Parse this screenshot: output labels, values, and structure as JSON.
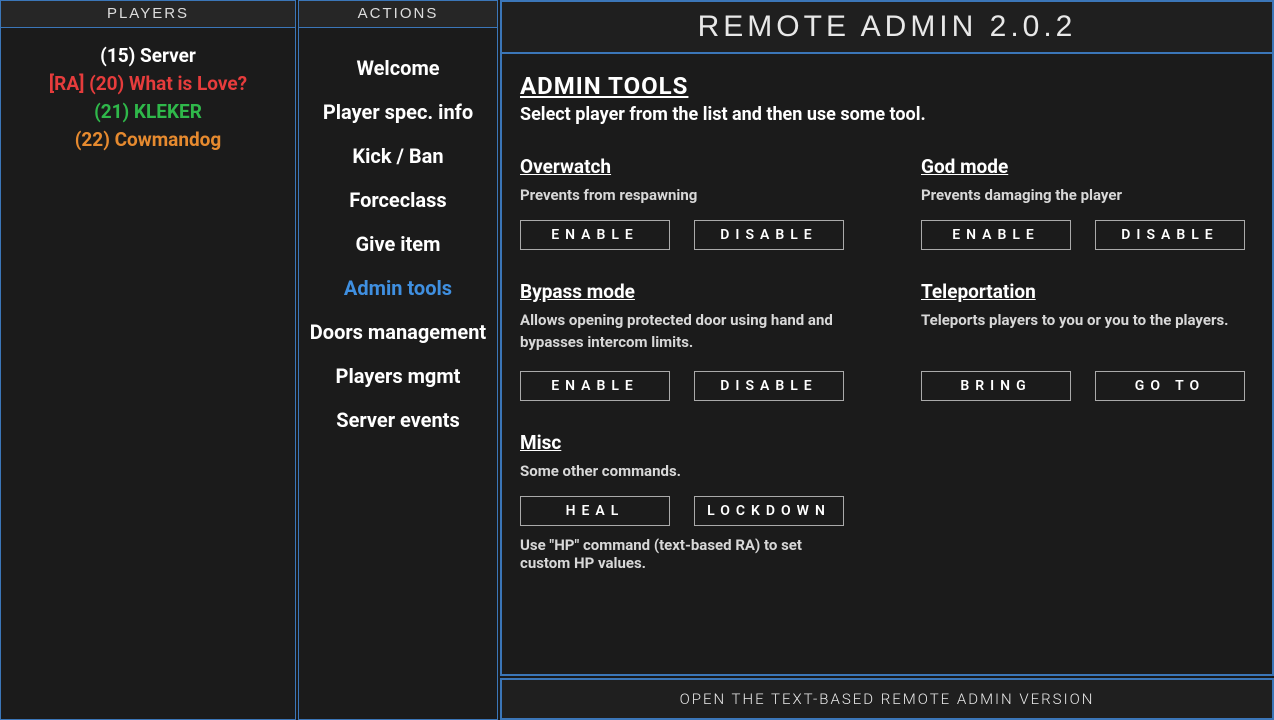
{
  "players_header": "PLAYERS",
  "actions_header": "ACTIONS",
  "players": [
    {
      "label": "(15) Server",
      "color": "#ffffff"
    },
    {
      "label": "[RA] (20) What is Love?",
      "color": "#e63c3c"
    },
    {
      "label": "(21) KLEKER",
      "color": "#2fb84a"
    },
    {
      "label": "(22) Cowmandog",
      "color": "#e68a2f"
    }
  ],
  "actions": {
    "items": [
      "Welcome",
      "Player spec. info",
      "Kick / Ban",
      "Forceclass",
      "Give item",
      "Admin tools",
      "Doors management",
      "Players mgmt",
      "Server events"
    ],
    "active_index": 5
  },
  "title": "REMOTE ADMIN 2.0.2",
  "page": {
    "title": "ADMIN TOOLS",
    "subtitle": "Select player from the list and then use some tool."
  },
  "sections": {
    "overwatch": {
      "title": "Overwatch",
      "desc": "Prevents from respawning",
      "btn1": "ENABLE",
      "btn2": "DISABLE"
    },
    "god": {
      "title": "God mode",
      "desc": "Prevents damaging the player",
      "btn1": "ENABLE",
      "btn2": "DISABLE"
    },
    "bypass": {
      "title": "Bypass mode",
      "desc": "Allows opening protected door using hand and bypasses intercom limits.",
      "btn1": "ENABLE",
      "btn2": "DISABLE"
    },
    "teleport": {
      "title": "Teleportation",
      "desc": "Teleports players to you or you to the players.",
      "btn1": "BRING",
      "btn2": "GO TO"
    },
    "misc": {
      "title": "Misc",
      "desc": "Some other commands.",
      "btn1": "HEAL",
      "btn2": "LOCKDOWN"
    }
  },
  "footer_note": "Use \"HP\" command (text-based RA) to set custom HP values.",
  "bottom_bar": "OPEN THE TEXT-BASED REMOTE ADMIN VERSION"
}
